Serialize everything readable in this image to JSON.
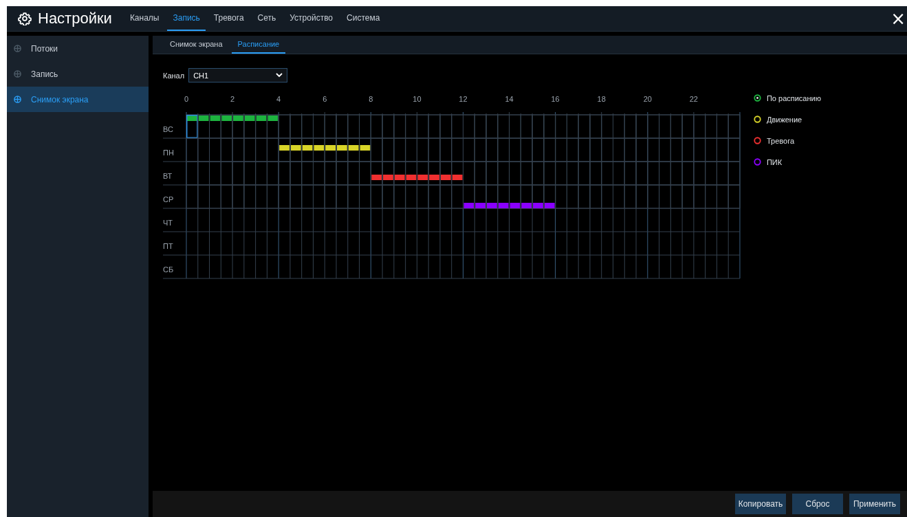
{
  "header": {
    "title": "Настройки",
    "tabs": [
      {
        "label": "Каналы",
        "selected": false
      },
      {
        "label": "Запись",
        "selected": true
      },
      {
        "label": "Тревога",
        "selected": false
      },
      {
        "label": "Сеть",
        "selected": false
      },
      {
        "label": "Устройство",
        "selected": false
      },
      {
        "label": "Система",
        "selected": false
      }
    ],
    "close": "×"
  },
  "sidebar": {
    "items": [
      {
        "label": "Потоки",
        "selected": false
      },
      {
        "label": "Запись",
        "selected": false
      },
      {
        "label": "Снимок экрана",
        "selected": true
      }
    ]
  },
  "subtabs": [
    {
      "label": "Снимок экрана",
      "selected": false
    },
    {
      "label": "Расписание",
      "selected": true
    }
  ],
  "channel": {
    "label": "Канал",
    "value": "CH1"
  },
  "schedule": {
    "hours": [
      "0",
      "2",
      "4",
      "6",
      "8",
      "10",
      "12",
      "14",
      "16",
      "18",
      "20",
      "22"
    ],
    "rows": [
      {
        "day": "ВС",
        "kind": "schedule",
        "cursor": true,
        "slots": [
          true,
          true,
          true,
          true,
          true,
          true,
          true,
          true,
          false,
          false,
          false,
          false,
          false,
          false,
          false,
          false,
          false,
          false,
          false,
          false,
          false,
          false,
          false,
          false,
          false,
          false,
          false,
          false,
          false,
          false,
          false,
          false,
          false,
          false,
          false,
          false,
          false,
          false,
          false,
          false,
          false,
          false,
          false,
          false,
          false,
          false,
          false,
          false
        ]
      },
      {
        "day": "ПН",
        "kind": "motion",
        "cursor": false,
        "slots": [
          false,
          false,
          false,
          false,
          false,
          false,
          false,
          false,
          true,
          true,
          true,
          true,
          true,
          true,
          true,
          true,
          false,
          false,
          false,
          false,
          false,
          false,
          false,
          false,
          false,
          false,
          false,
          false,
          false,
          false,
          false,
          false,
          false,
          false,
          false,
          false,
          false,
          false,
          false,
          false,
          false,
          false,
          false,
          false,
          false,
          false,
          false,
          false
        ]
      },
      {
        "day": "ВТ",
        "kind": "alarm",
        "cursor": false,
        "slots": [
          false,
          false,
          false,
          false,
          false,
          false,
          false,
          false,
          false,
          false,
          false,
          false,
          false,
          false,
          false,
          false,
          true,
          true,
          true,
          true,
          true,
          true,
          true,
          true,
          false,
          false,
          false,
          false,
          false,
          false,
          false,
          false,
          false,
          false,
          false,
          false,
          false,
          false,
          false,
          false,
          false,
          false,
          false,
          false,
          false,
          false,
          false,
          false
        ]
      },
      {
        "day": "СР",
        "kind": "pik",
        "cursor": false,
        "slots": [
          false,
          false,
          false,
          false,
          false,
          false,
          false,
          false,
          false,
          false,
          false,
          false,
          false,
          false,
          false,
          false,
          false,
          false,
          false,
          false,
          false,
          false,
          false,
          false,
          true,
          true,
          true,
          true,
          true,
          true,
          true,
          true,
          false,
          false,
          false,
          false,
          false,
          false,
          false,
          false,
          false,
          false,
          false,
          false,
          false,
          false,
          false,
          false
        ]
      },
      {
        "day": "ЧТ",
        "cursor": false
      },
      {
        "day": "ПТ",
        "cursor": false
      },
      {
        "day": "СБ",
        "cursor": false
      }
    ]
  },
  "legend": [
    {
      "kind": "schedule",
      "label": "По расписанию",
      "color": "#1db33f",
      "selected": true
    },
    {
      "kind": "motion",
      "label": "Движение",
      "color": "#d8d428",
      "selected": false
    },
    {
      "kind": "alarm",
      "label": "Тревога",
      "color": "#f03030",
      "selected": false
    },
    {
      "kind": "pik",
      "label": "ПИК",
      "color": "#8a00ff",
      "selected": false
    }
  ],
  "buttons": [
    "Копировать",
    "Сброс",
    "Применить"
  ]
}
